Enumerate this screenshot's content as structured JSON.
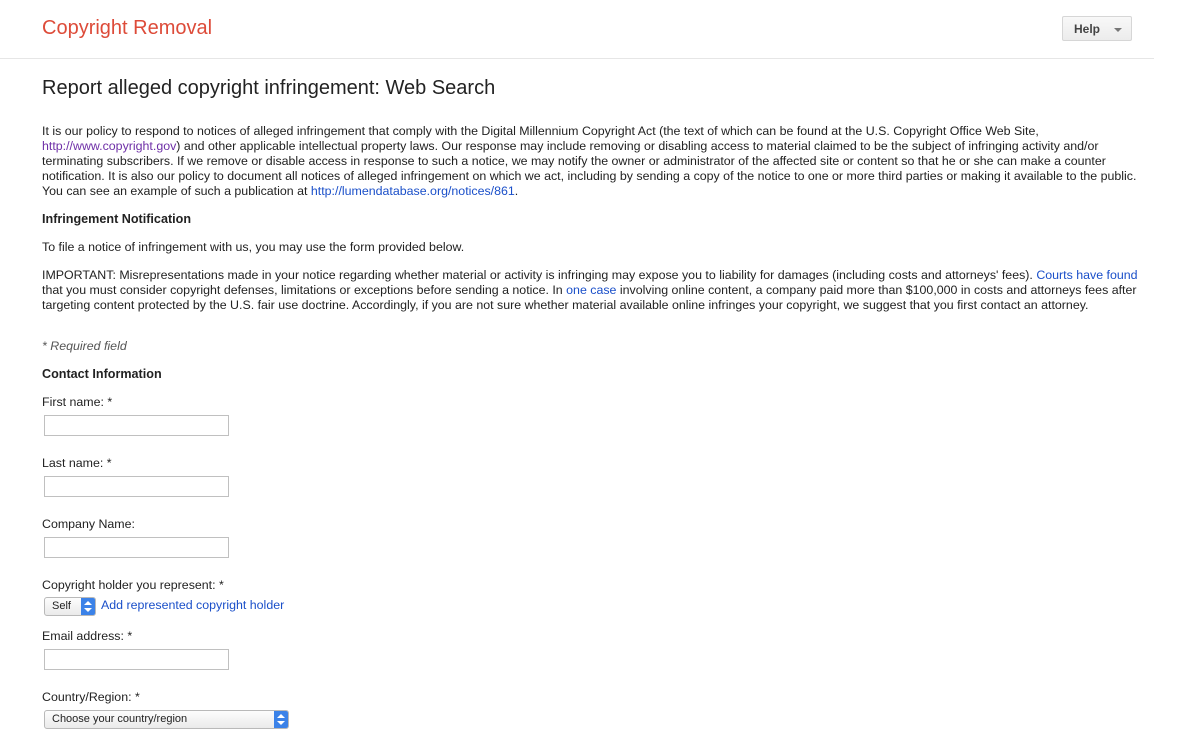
{
  "header": {
    "app_title": "Copyright Removal",
    "help_label": "Help"
  },
  "page": {
    "title": "Report alleged copyright infringement: Web Search",
    "intro": {
      "part1": "It is our policy to respond to notices of alleged infringement that comply with the Digital Millennium Copyright Act (the text of which can be found at the U.S. Copyright Office Web Site,",
      "link1": "http://www.copyright.gov",
      "part2": ") and other applicable intellectual property laws. Our response may include removing or disabling access to material claimed to be the subject of infringing activity and/or terminating subscribers. If we remove or disable access in response to such a notice, we may notify the owner or administrator of the affected site or content so that he or she can make a counter notification. It is also our policy to document all notices of alleged infringement on which we act, including by sending a copy of the notice to one or more third parties or making it available to the public. You can see an example of such a publication at",
      "link2": "http://lumendatabase.org/notices/861",
      "part3": "."
    },
    "infringement_heading": "Infringement Notification",
    "file_notice": "To file a notice of infringement with us, you may use the form provided below.",
    "important": {
      "part1": "IMPORTANT: Misrepresentations made in your notice regarding whether material or activity is infringing may expose you to liability for damages (including costs and attorneys' fees).",
      "link1": "Courts have found",
      "part2": "that you must consider copyright defenses, limitations or exceptions before sending a notice. In",
      "link2": "one case",
      "part3": "involving online content, a company paid more than $100,000 in costs and attorneys fees after targeting content protected by the U.S. fair use doctrine. Accordingly, if you are not sure whether material available online infringes your copyright, we suggest that you first contact an attorney."
    },
    "required_note": "* Required field",
    "contact_heading": "Contact Information"
  },
  "form": {
    "first_name_label": "First name: *",
    "first_name_value": "",
    "last_name_label": "Last name: *",
    "last_name_value": "",
    "company_label": "Company Name:",
    "company_value": "",
    "holder_label": "Copyright holder you represent: *",
    "holder_selected": "Self",
    "add_holder_link": "Add represented copyright holder",
    "email_label": "Email address: *",
    "email_value": "",
    "country_label": "Country/Region: *",
    "country_selected": "Choose your country/region"
  }
}
